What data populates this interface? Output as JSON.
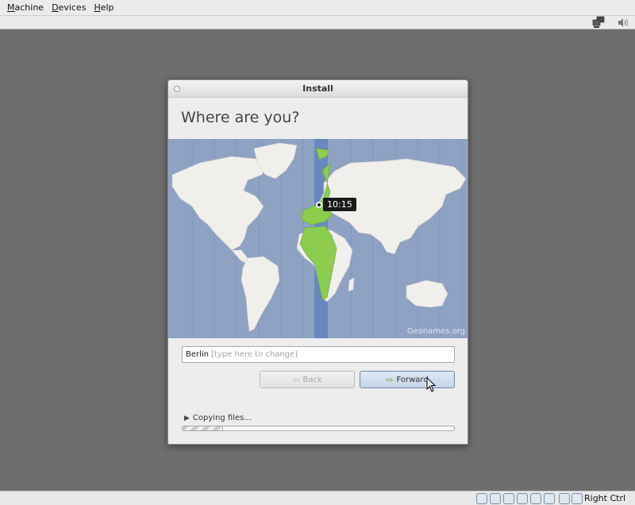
{
  "menubar": {
    "items": [
      "Machine",
      "Devices",
      "Help"
    ]
  },
  "toolbar": {
    "icons": [
      "network-icon",
      "speaker-icon"
    ]
  },
  "dialog": {
    "window_title": "Install",
    "heading": "Where are you?",
    "map": {
      "credit": "Geonames.org",
      "time_label": "10:15",
      "highlight_color": "#8ccc4e"
    },
    "timezone_input": {
      "value": "Berlin",
      "hint": "[type here to change]"
    },
    "buttons": {
      "back_label": "Back",
      "forward_label": "Forward"
    },
    "progress": {
      "label": "Copying files...",
      "fraction": 0.15
    }
  },
  "statusbar": {
    "host_key_label": "Right Ctrl"
  }
}
